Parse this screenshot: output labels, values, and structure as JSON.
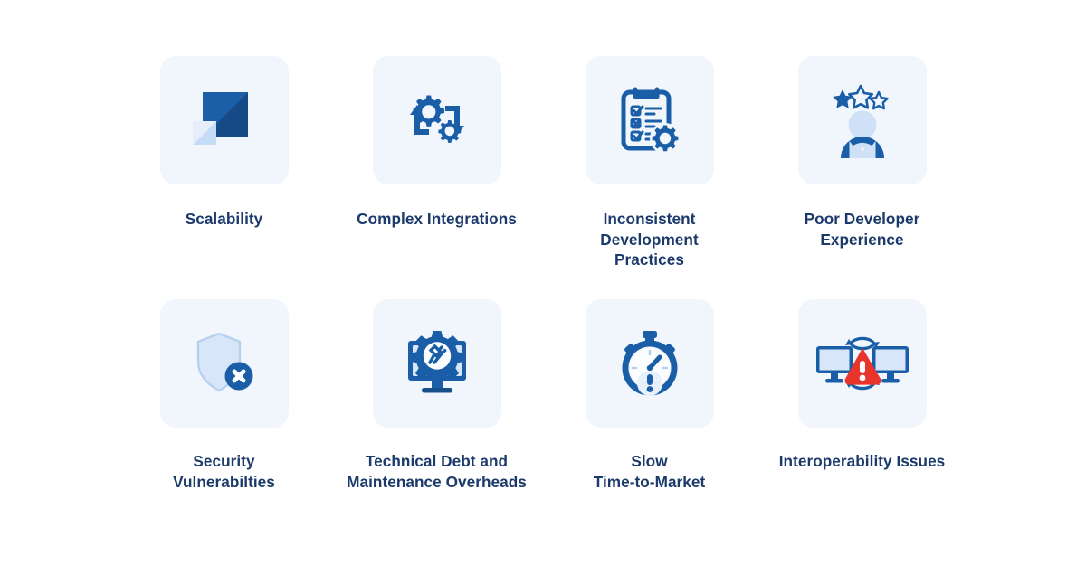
{
  "colors": {
    "page_background": "#ffffff",
    "tile_background": "#f1f6fd",
    "label_text": "#1b3a6b",
    "icon_primary": "#1b5ea8",
    "icon_dark": "#174e8c",
    "icon_light": "#cfe1f6",
    "icon_mid": "#2a6ebb",
    "warning_red": "#e8342a"
  },
  "grid": {
    "columns": 4,
    "rows": 2,
    "items": [
      {
        "id": "scalability",
        "label": "Scalability",
        "icon": "scalability-squares-icon",
        "row": 1,
        "column": 1
      },
      {
        "id": "complex-integrations",
        "label": "Complex Integrations",
        "icon": "gears-cycle-icon",
        "row": 1,
        "column": 2
      },
      {
        "id": "inconsistent-development-practices",
        "label": "Inconsistent\nDevelopment\nPractices",
        "icon": "clipboard-checklist-gear-icon",
        "row": 1,
        "column": 3
      },
      {
        "id": "poor-developer-experience",
        "label": "Poor Developer\nExperience",
        "icon": "user-rating-stars-icon",
        "row": 1,
        "column": 4
      },
      {
        "id": "security-vulnerabilties",
        "label": "Security\nVulnerabilties",
        "icon": "shield-error-icon",
        "row": 2,
        "column": 1
      },
      {
        "id": "technical-debt-and-maintenance-overheads",
        "label": "Technical Debt and\nMaintenance Overheads",
        "icon": "monitor-gear-tools-icon",
        "row": 2,
        "column": 2
      },
      {
        "id": "slow-time-to-market",
        "label": "Slow\nTime-to-Market",
        "icon": "stopwatch-alert-icon",
        "row": 2,
        "column": 3
      },
      {
        "id": "interoperability-issues",
        "label": "Interoperability Issues",
        "icon": "monitors-sync-warning-icon",
        "row": 2,
        "column": 4
      }
    ]
  }
}
